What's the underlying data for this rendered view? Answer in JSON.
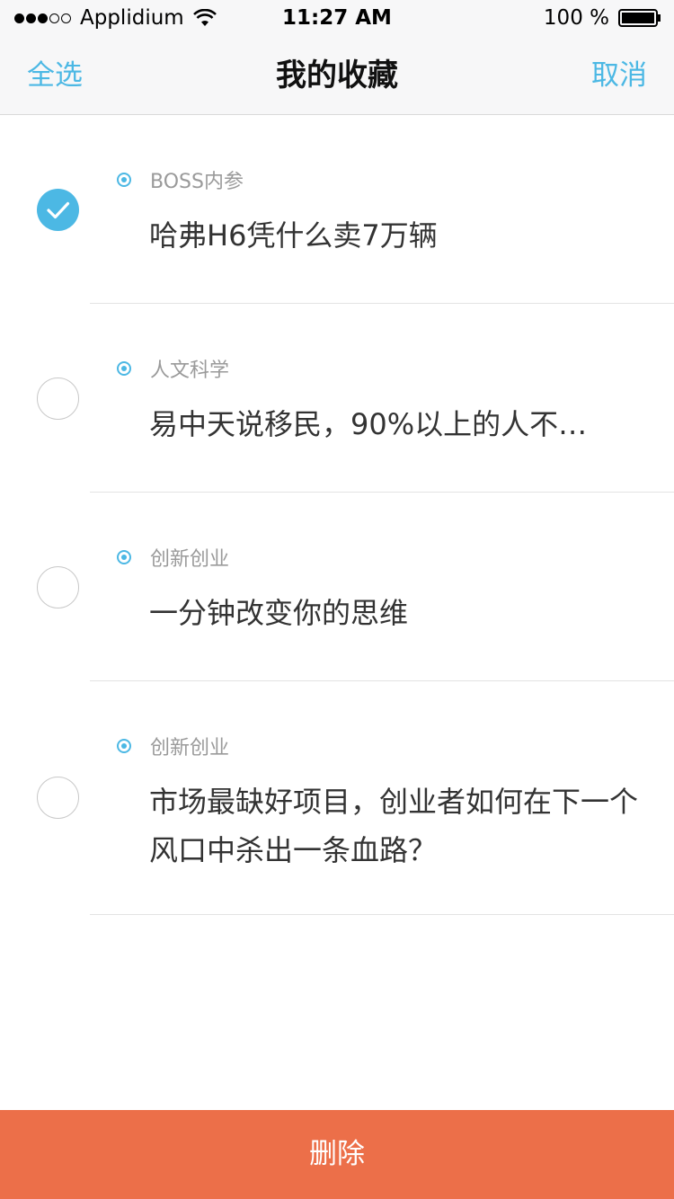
{
  "status_bar": {
    "carrier": "Applidium",
    "time": "11:27 AM",
    "battery": "100 %"
  },
  "nav": {
    "select_all": "全选",
    "title": "我的收藏",
    "cancel": "取消"
  },
  "items": [
    {
      "category": "BOSS内参",
      "title": "哈弗H6凭什么卖7万辆",
      "checked": true
    },
    {
      "category": "人文科学",
      "title": "易中天说移民，90%以上的人不…",
      "checked": false
    },
    {
      "category": "创新创业",
      "title": "一分钟改变你的思维",
      "checked": false
    },
    {
      "category": "创新创业",
      "title": "市场最缺好项目，创业者如何在下一个风口中杀出一条血路？",
      "checked": false
    }
  ],
  "delete_button": "删除",
  "colors": {
    "accent": "#4cb8e4",
    "delete_bar": "#ec6f49"
  }
}
